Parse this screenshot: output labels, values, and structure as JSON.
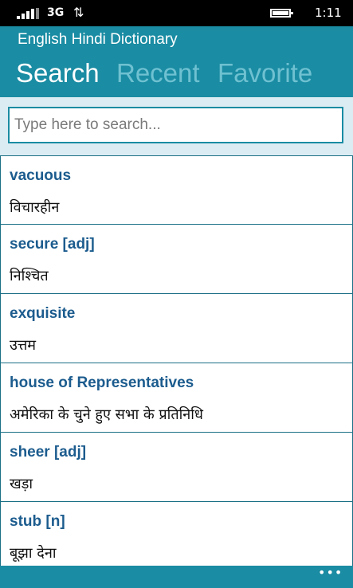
{
  "status_bar": {
    "network": "3G",
    "time": "1:11"
  },
  "app": {
    "title": "English Hindi Dictionary"
  },
  "tabs": [
    {
      "label": "Search",
      "active": true
    },
    {
      "label": "Recent",
      "active": false
    },
    {
      "label": "Favorite",
      "active": false
    }
  ],
  "search": {
    "placeholder": "Type here to search...",
    "value": ""
  },
  "entries": [
    {
      "word": "vacuous",
      "meaning": "विचारहीन"
    },
    {
      "word": "secure [adj]",
      "meaning": "निश्चित"
    },
    {
      "word": "exquisite",
      "meaning": "उत्तम"
    },
    {
      "word": "house of Representatives",
      "meaning": "अमेरिका के चुने हुए सभा के प्रतिनिधि"
    },
    {
      "word": "sheer [adj]",
      "meaning": "खड़ा"
    },
    {
      "word": "stub [n]",
      "meaning": "बूझा देना"
    }
  ],
  "app_bar": {
    "more_icon": "ellipsis-icon"
  },
  "colors": {
    "accent": "#1a8ca3",
    "word": "#1c5c8e",
    "inactive_tab": "#6fc1d1"
  }
}
